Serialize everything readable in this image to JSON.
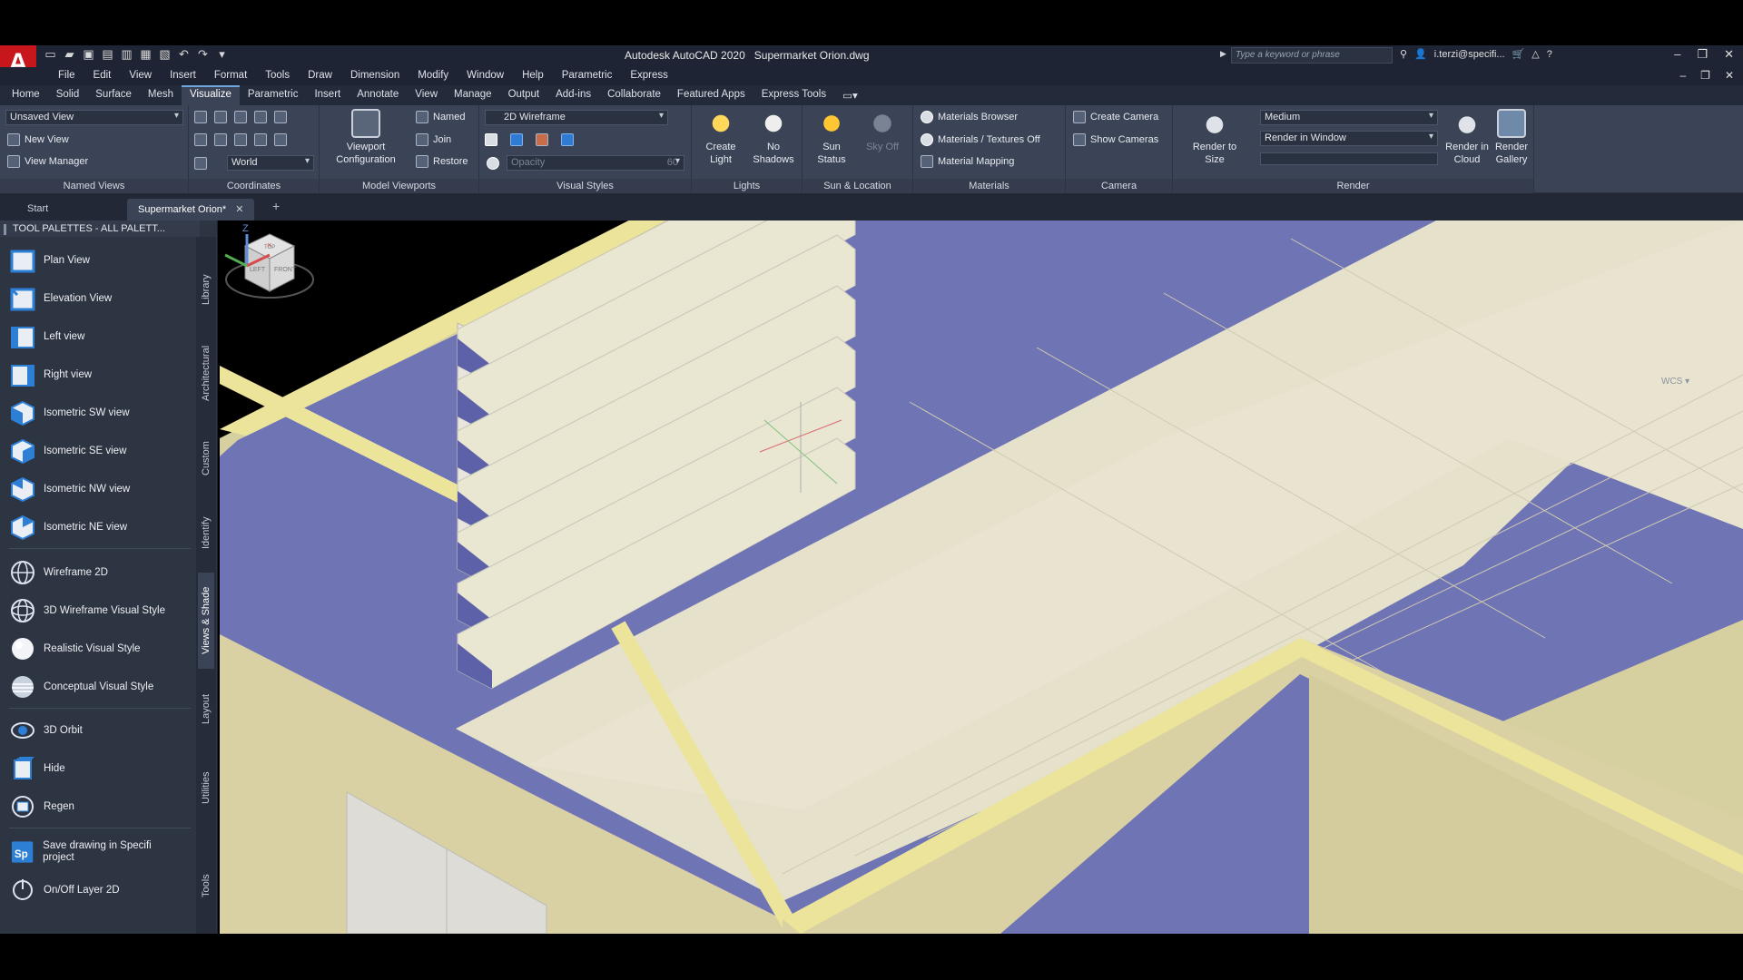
{
  "app": {
    "logo": "A",
    "title": "Autodesk AutoCAD 2020",
    "document": "Supermarket Orion.dwg",
    "search_placeholder": "Type a keyword or phrase",
    "user": "i.terzi@specifi..."
  },
  "menubar": [
    "File",
    "Edit",
    "View",
    "Insert",
    "Format",
    "Tools",
    "Draw",
    "Dimension",
    "Modify",
    "Window",
    "Help",
    "Parametric",
    "Express"
  ],
  "ribbon_tabs": [
    "Home",
    "Solid",
    "Surface",
    "Mesh",
    "Visualize",
    "Parametric",
    "Insert",
    "Annotate",
    "View",
    "Manage",
    "Output",
    "Add-ins",
    "Collaborate",
    "Featured Apps",
    "Express Tools"
  ],
  "ribbon_active_tab": "Visualize",
  "panels": {
    "named_views": {
      "title": "Named Views",
      "combo": "Unsaved View",
      "new_view": "New View",
      "view_manager": "View Manager"
    },
    "coordinates": {
      "title": "Coordinates",
      "combo": "World"
    },
    "model_viewports": {
      "title": "Model Viewports",
      "viewport_config": "Viewport Configuration",
      "named": "Named",
      "join": "Join",
      "restore": "Restore"
    },
    "visual_styles": {
      "title": "Visual Styles",
      "combo": "2D Wireframe",
      "opacity_placeholder": "Opacity",
      "opacity_value": "60"
    },
    "lights": {
      "title": "Lights",
      "create_light": "Create Light",
      "no_shadows": "No Shadows"
    },
    "sun_location": {
      "title": "Sun & Location",
      "sun_status": "Sun Status",
      "sky_off": "Sky Off"
    },
    "materials": {
      "title": "Materials",
      "browser": "Materials Browser",
      "textures": "Materials / Textures Off",
      "mapping": "Material Mapping"
    },
    "camera": {
      "title": "Camera",
      "create": "Create Camera",
      "show": "Show  Cameras"
    },
    "render": {
      "title": "Render",
      "render_to_size": "Render to Size",
      "quality": "Medium",
      "target": "Render in Window",
      "render_cloud": "Render in Cloud",
      "render_gallery": "Render Gallery"
    }
  },
  "file_tabs": {
    "start": "Start",
    "active": "Supermarket Orion*"
  },
  "palette": {
    "header": "TOOL PALETTES - ALL PALETT...",
    "items": [
      {
        "label": "Plan View",
        "icon": "plan-view-icon"
      },
      {
        "label": "Elevation View",
        "icon": "elevation-view-icon"
      },
      {
        "label": "Left view",
        "icon": "left-view-icon"
      },
      {
        "label": "Right view",
        "icon": "right-view-icon"
      },
      {
        "label": "Isometric SW view",
        "icon": "iso-sw-icon"
      },
      {
        "label": "Isometric SE view",
        "icon": "iso-se-icon"
      },
      {
        "label": "Isometric NW view",
        "icon": "iso-nw-icon"
      },
      {
        "label": "Isometric NE view",
        "icon": "iso-ne-icon"
      },
      {
        "label": "Wireframe 2D",
        "icon": "wireframe-2d-icon"
      },
      {
        "label": "3D Wireframe Visual Style",
        "icon": "wireframe-3d-icon"
      },
      {
        "label": "Realistic Visual Style",
        "icon": "realistic-style-icon"
      },
      {
        "label": "Conceptual Visual Style",
        "icon": "conceptual-style-icon"
      },
      {
        "label": "3D Orbit",
        "icon": "orbit-icon"
      },
      {
        "label": "Hide",
        "icon": "hide-icon"
      },
      {
        "label": "Regen",
        "icon": "regen-icon"
      },
      {
        "label": "Save drawing in Specifi project",
        "icon": "specifi-save-icon"
      },
      {
        "label": "On/Off Layer 2D",
        "icon": "layer-toggle-icon"
      }
    ],
    "side_tabs": [
      "Library",
      "Architectural",
      "Custom",
      "Identify",
      "Views & Shade",
      "Layout",
      "Utilities",
      "Tools"
    ],
    "active_side_tab": "Views & Shade"
  },
  "viewcube": {
    "top": "TOP",
    "left": "LEFT",
    "front": "FRONT",
    "wcs": "WCS"
  },
  "colors": {
    "floor": "#e9e4cf",
    "wall": "#d9d3a8",
    "wall_top": "#ece59c",
    "blue_surface": "#6f74b4",
    "ribbon_bg": "#3b4456",
    "app_red": "#c8161d"
  }
}
